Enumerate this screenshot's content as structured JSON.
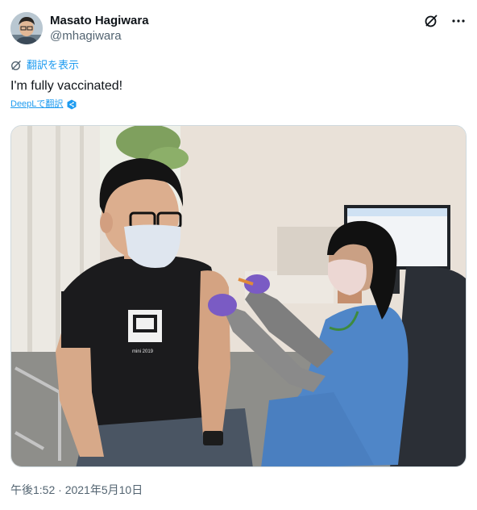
{
  "user": {
    "display_name": "Masato Hagiwara",
    "handle": "@mhagiwara"
  },
  "header_icons": [
    "grok-icon",
    "more-options-icon"
  ],
  "translate": {
    "label": "翻訳を表示"
  },
  "tweet": {
    "text": "I'm fully vaccinated!"
  },
  "deepl": {
    "label": "DeepLで翻訳"
  },
  "media": {
    "shirt_logo_text": "mini 2019"
  },
  "timestamp": "午後1:52 · 2021年5月10日",
  "colors": {
    "link": "#1d9bf0",
    "secondary_text": "#536471",
    "primary_text": "#0f1419"
  }
}
